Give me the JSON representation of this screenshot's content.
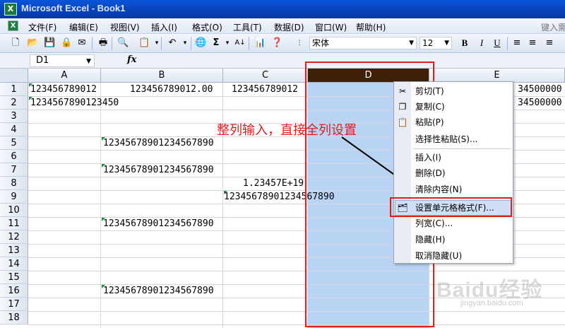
{
  "window": {
    "title": "Microsoft Excel - Book1",
    "app_icon": "X"
  },
  "menubar": {
    "items": [
      "文件(F)",
      "编辑(E)",
      "视图(V)",
      "插入(I)",
      "格式(O)",
      "工具(T)",
      "数据(D)",
      "窗口(W)",
      "帮助(H)"
    ],
    "help_input": "键入需"
  },
  "toolbar": {
    "font": "宋体",
    "size": "12",
    "bold": "B",
    "italic": "I",
    "underline": "U",
    "sum": "Σ"
  },
  "formulabar": {
    "namebox": "D1",
    "fx": "fx"
  },
  "grid": {
    "columns": [
      "A",
      "B",
      "C",
      "D",
      "E"
    ],
    "selected_column": "D",
    "rows": [
      "1",
      "2",
      "3",
      "4",
      "5",
      "6",
      "7",
      "8",
      "9",
      "10",
      "11",
      "12",
      "13",
      "14",
      "15",
      "16",
      "17",
      "18"
    ],
    "cells": {
      "A1": "123456789012",
      "B1": "123456789012.00",
      "C1": "123456789012",
      "E1": "34500000",
      "A2": "1234567890123450",
      "E2": "34500000",
      "B5": "12345678901234567890",
      "B7": "12345678901234567890",
      "C8": "1.23457E+19",
      "C9": "12345678901234567890",
      "B11": "12345678901234567890",
      "B16": "12345678901234567890"
    }
  },
  "annotation": {
    "text": "整列输入，直接全列设置"
  },
  "context_menu": {
    "items": [
      {
        "label": "剪切(T)",
        "icon": "scissors-icon"
      },
      {
        "label": "复制(C)",
        "icon": "copy-icon"
      },
      {
        "label": "粘贴(P)",
        "icon": "paste-icon"
      },
      {
        "label": "选择性粘贴(S)...",
        "icon": ""
      },
      {
        "label": "插入(I)",
        "icon": ""
      },
      {
        "label": "删除(D)",
        "icon": ""
      },
      {
        "label": "清除内容(N)",
        "icon": ""
      },
      {
        "label": "设置单元格格式(F)...",
        "icon": "format-cells-icon"
      },
      {
        "label": "列宽(C)...",
        "icon": ""
      },
      {
        "label": "隐藏(H)",
        "icon": ""
      },
      {
        "label": "取消隐藏(U)",
        "icon": ""
      }
    ]
  },
  "watermark": {
    "logo": "Baidu经验",
    "url": "jingyan.baidu.com"
  },
  "colors": {
    "annotation_red": "#e21c1c",
    "selection_blue": "#b8d4f2",
    "selected_header": "#3c2008"
  }
}
